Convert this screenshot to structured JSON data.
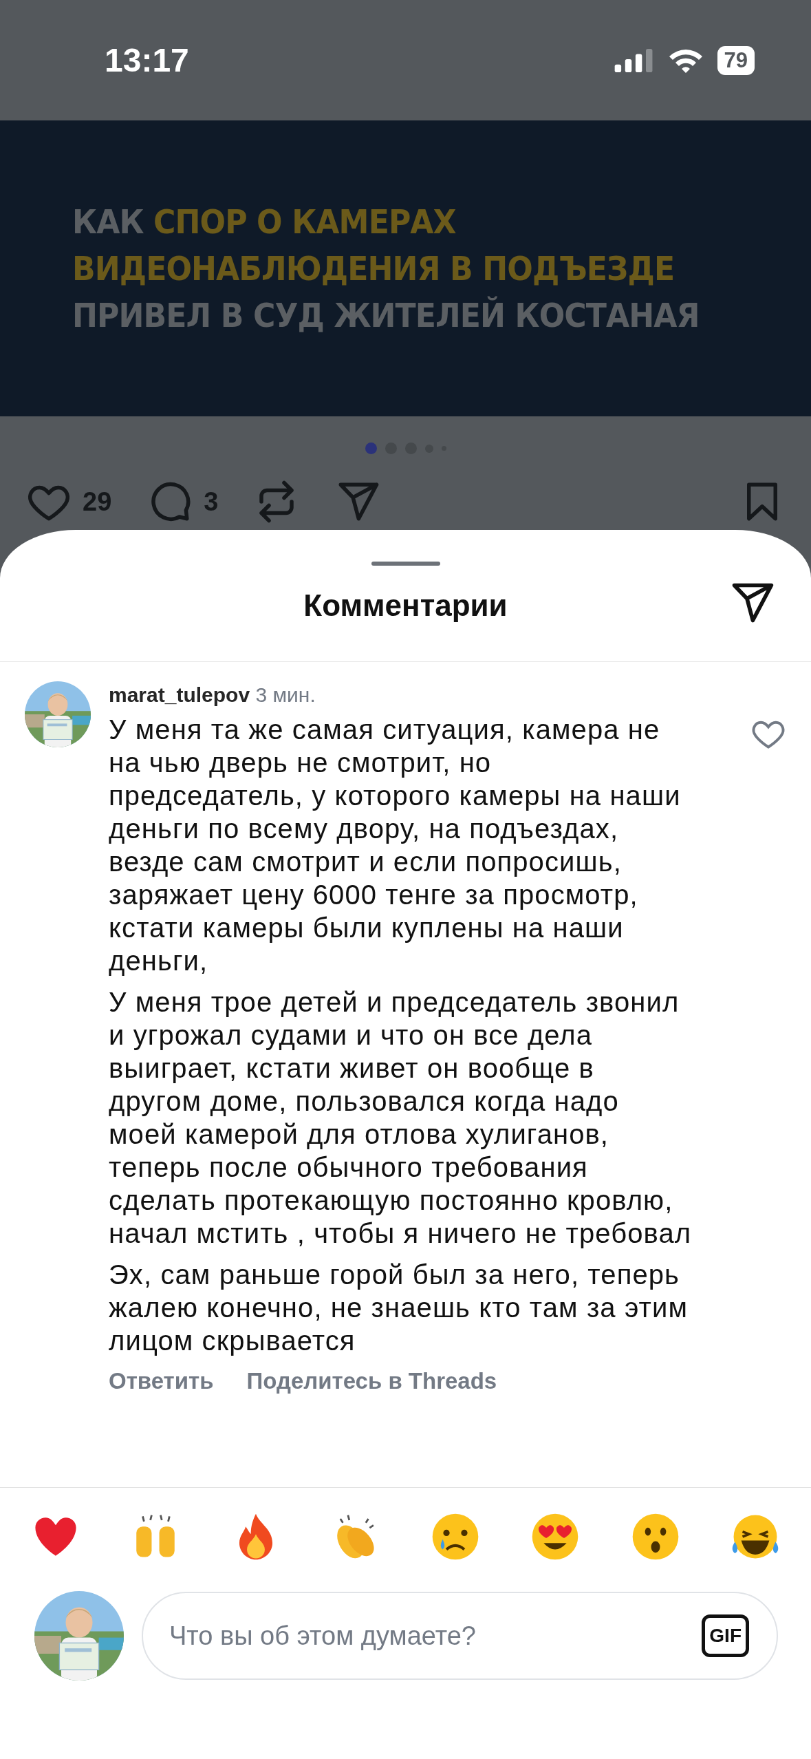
{
  "status_bar": {
    "time": "13:17",
    "battery": "79"
  },
  "post": {
    "headline": [
      [
        {
          "text": "КАК ",
          "highlight": false
        },
        {
          "text": "СПОР О КАМЕРАХ",
          "highlight": true
        }
      ],
      [
        {
          "text": "ВИДЕОНАБЛЮДЕНИЯ В ПОДЪЕЗДЕ",
          "highlight": true
        }
      ],
      [
        {
          "text": "ПРИВЕЛ В СУД ЖИТЕЛЕЙ КОСТАНАЯ",
          "highlight": false
        }
      ]
    ],
    "carousel": [
      {
        "selected": true
      },
      {
        "selected": false
      },
      {
        "selected": false
      },
      {
        "selected": false
      },
      {
        "selected": false
      }
    ],
    "likes": "29",
    "comments": "3"
  },
  "sheet": {
    "title": "Комментарии"
  },
  "comments": [
    {
      "username": "marat_tulepov",
      "time": "3 мин.",
      "liked": false,
      "paragraphs": [
        "У меня та же самая ситуация, камера не на чью дверь не смотрит, но председатель, у которого камеры на наши деньги по всему двору, на подъездах, везде сам смотрит и если попросишь, заряжает цену 6000 тенге за просмотр, кстати камеры были куплены на наши деньги,",
        "У меня трое детей и председатель звонил и угрожал судами и что он все дела выиграет, кстати живет он вообще в другом доме, пользовался когда надо моей камерой для отлова хулиганов, теперь после обычного требования сделать протекающую постоянно кровлю, начал мстить , чтобы я ничего не требовал",
        "Эх, сам раньше горой был за него, теперь жалею конечно, не знаешь кто там за этим лицом скрывается"
      ],
      "actions": [
        "Ответить",
        "Поделитесь в Threads"
      ]
    }
  ],
  "reactions": [
    {
      "kind": "heart"
    },
    {
      "kind": "raised-hands"
    },
    {
      "kind": "fire"
    },
    {
      "kind": "clap"
    },
    {
      "kind": "crying"
    },
    {
      "kind": "heart-eyes"
    },
    {
      "kind": "surprised"
    },
    {
      "kind": "laughing"
    }
  ],
  "composer": {
    "placeholder": "Что вы об этом думаете?",
    "gif": "GIF"
  }
}
